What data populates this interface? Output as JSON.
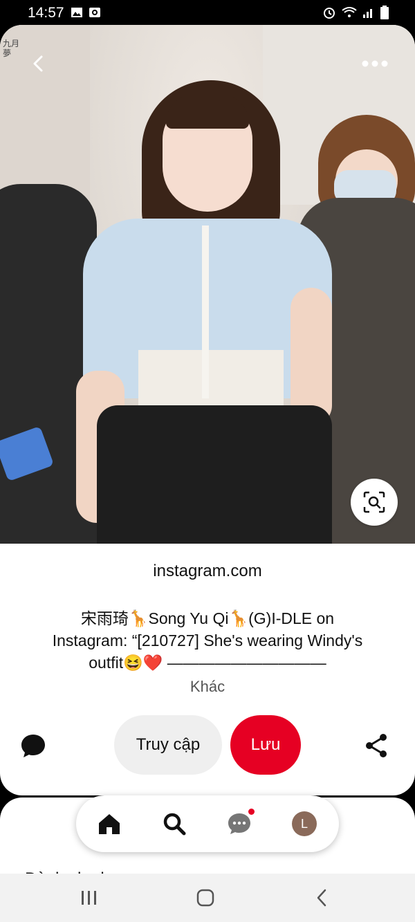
{
  "status_bar": {
    "time": "14:57"
  },
  "pin": {
    "watermark": "九月夢",
    "source": "instagram.com",
    "description": "宋雨琦🦒Song Yu Qi🦒(G)I-DLE on Instagram: “[210727] She's wearing Windy's outfit😆❤️ ——————————",
    "more_label": "Khác",
    "visit_label": "Truy cập",
    "save_label": "Lưu"
  },
  "next_section": {
    "peek_text": "Dành cho bạn"
  },
  "bottom_nav": {
    "avatar_initial": "L"
  },
  "colors": {
    "accent": "#e60023",
    "visit_bg": "#efefef"
  }
}
